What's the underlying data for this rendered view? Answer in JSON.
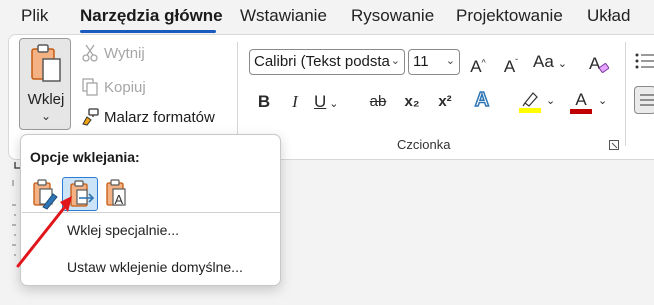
{
  "tabs": [
    {
      "label": "Plik",
      "active": false
    },
    {
      "label": "Narzędzia główne",
      "active": true
    },
    {
      "label": "Wstawianie",
      "active": false
    },
    {
      "label": "Rysowanie",
      "active": false
    },
    {
      "label": "Projektowanie",
      "active": false
    },
    {
      "label": "Układ",
      "active": false
    }
  ],
  "clipboard": {
    "paste_label": "Wklej",
    "cut_label": "Wytnij",
    "copy_label": "Kopiuj",
    "format_painter_label": "Malarz formatów"
  },
  "font": {
    "name_value": "Calibri (Tekst podsta",
    "size_value": "11",
    "grow_label": "A^",
    "shrink_label": "A˅",
    "case_label": "Aa",
    "group_label": "Czcionka",
    "bold": "B",
    "italic": "I",
    "underline": "U",
    "strike": "ab",
    "subscript": "x₂",
    "superscript": "x²",
    "text_effects": "A",
    "font_color": "A",
    "highlight_color": "#ffff00",
    "font_color_value": "#c00000"
  },
  "paste_menu": {
    "title": "Opcje wklejania:",
    "options": [
      "keep-source-formatting",
      "merge-formatting",
      "keep-text-only"
    ],
    "selected_option": "merge-formatting",
    "items": [
      "Wklej specjalnie...",
      "Ustaw wklejenie domyślne..."
    ]
  },
  "colors": {
    "accent": "#185abd",
    "arrow": "#e0161b",
    "selected_bg": "#cce4f7"
  }
}
